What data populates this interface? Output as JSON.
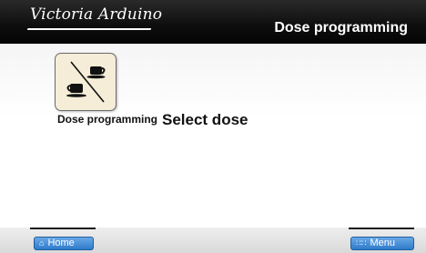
{
  "header": {
    "brand": "Victoria Arduino",
    "title": "Dose programming"
  },
  "main": {
    "tile_label": "Dose programming",
    "prompt": "Select dose"
  },
  "footer": {
    "home_label": "Home",
    "home_icon": "home-icon",
    "menu_label": "Menu",
    "menu_icon": "grid-icon"
  },
  "colors": {
    "header_bg": "#0e0e0e",
    "tile_bg": "#f5edd7",
    "button_blue": "#2f7acb"
  }
}
